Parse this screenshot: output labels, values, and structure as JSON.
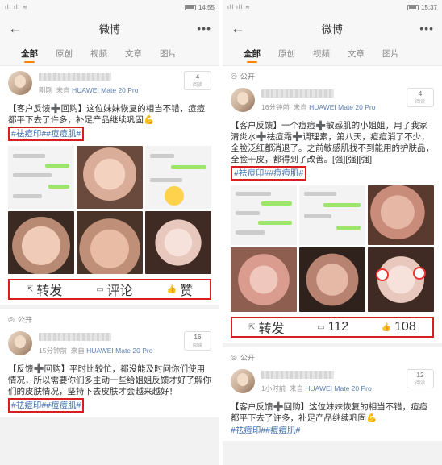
{
  "left": {
    "status": {
      "signal": "ıll  ıll  ≋",
      "time": "14:55"
    },
    "nav": {
      "title": "微博"
    },
    "tabs": [
      "全部",
      "原创",
      "视频",
      "文章",
      "图片"
    ],
    "post1": {
      "time": "刚刚",
      "source_prefix": "来自",
      "device": "HUAWEI Mate 20 Pro",
      "reads": "4",
      "reads_label": "阅读",
      "text": "【客户反馈➕回购】这位妹妹恢复的相当不错，痘痘都平下去了许多，补足产品继续巩固💪",
      "tags": "#祛痘印##痘痘肌#",
      "actions": {
        "repost": "转发",
        "comment": "评论",
        "like": "赞"
      }
    },
    "section": "公开",
    "post2": {
      "time": "15分钟前",
      "source_prefix": "来自",
      "device": "HUAWEI Mate 20 Pro",
      "reads": "16",
      "reads_label": "阅读",
      "text": "【反馈➕回购】平时比较忙，都没能及时问你们使用情况，所以需要你们多主动一些给姐姐反馈才好了解你们的皮肤情况，坚持下去皮肤才会越来越好！",
      "tags": "#祛痘印##痘痘肌#"
    }
  },
  "right": {
    "status": {
      "signal": "ıll  ıll  ≋",
      "time": "15:37"
    },
    "nav": {
      "title": "微博"
    },
    "tabs": [
      "全部",
      "原创",
      "视频",
      "文章",
      "图片"
    ],
    "section1": "公开",
    "post1": {
      "time": "16分钟前",
      "source_prefix": "来自",
      "device": "HUAWEI Mate 20 Pro",
      "reads": "4",
      "reads_label": "阅读",
      "text": "【客户反馈】一个痘痘➕敏感肌的小姐姐，用了我家清炎水➕祛痘霜➕调理素，第八天，痘痘消了不少，全脸泛红都消退了。之前敏感肌找不到能用的护肤品，全脸干皮，都得到了改善。[强][强][强]",
      "tags": "#祛痘印##痘痘肌#",
      "actions": {
        "repost": "转发",
        "comment": "112",
        "like": "108"
      }
    },
    "section2": "公开",
    "post2": {
      "time": "1小时前",
      "source_prefix": "来自",
      "device": "HUAWEI Mate 20 Pro",
      "reads": "12",
      "reads_label": "阅读",
      "text": "【客户反馈➕回购】这位妹妹恢复的相当不错，痘痘都平下去了许多，补足产品继续巩固💪",
      "tags": "#祛痘印##痘痘肌#"
    }
  }
}
